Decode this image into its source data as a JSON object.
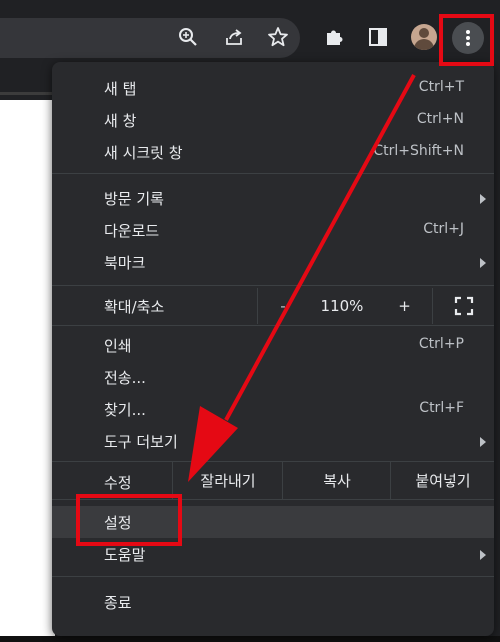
{
  "menu": {
    "new_tab": {
      "label": "새 탭",
      "shortcut": "Ctrl+T"
    },
    "new_window": {
      "label": "새 창",
      "shortcut": "Ctrl+N"
    },
    "incognito": {
      "label": "새 시크릿 창",
      "shortcut": "Ctrl+Shift+N"
    },
    "history": {
      "label": "방문 기록"
    },
    "downloads": {
      "label": "다운로드",
      "shortcut": "Ctrl+J"
    },
    "bookmarks": {
      "label": "북마크"
    },
    "zoom": {
      "label": "확대/축소",
      "minus": "-",
      "value": "110%",
      "plus": "+"
    },
    "print": {
      "label": "인쇄",
      "shortcut": "Ctrl+P"
    },
    "cast": {
      "label": "전송..."
    },
    "find": {
      "label": "찾기...",
      "shortcut": "Ctrl+F"
    },
    "more_tools": {
      "label": "도구 더보기"
    },
    "edit": {
      "label": "수정",
      "cut": "잘라내기",
      "copy": "복사",
      "paste": "붙여넣기"
    },
    "settings": {
      "label": "설정"
    },
    "help": {
      "label": "도움말"
    },
    "exit": {
      "label": "종료"
    }
  },
  "toolbar_icons": [
    "zoom-icon",
    "share-icon",
    "star-icon",
    "extensions-icon",
    "side-panel-icon",
    "profile-avatar",
    "more-menu-icon"
  ],
  "annotation_color": "#e50914"
}
